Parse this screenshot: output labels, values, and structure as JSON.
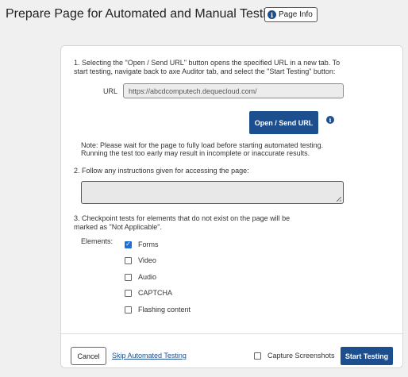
{
  "header": {
    "title": "Prepare Page for Automated and Manual Testing",
    "page_info_label": "Page Info",
    "info_icon": "info-icon"
  },
  "step1": {
    "text": "1. Selecting the \"Open / Send URL\" button opens the specified URL in a new tab. To start testing, navigate back to axe Auditor tab, and select the \"Start Testing\" button:",
    "url_label": "URL",
    "url_value": "https://abcdcomputech.dequecloud.com/",
    "open_send_label": "Open / Send URL",
    "note": "Note: Please wait for the page to fully load before starting automated testing. Running the test too early may result in incomplete or inaccurate results."
  },
  "step2": {
    "text": "2. Follow any instructions given for accessing the page:",
    "instructions_value": ""
  },
  "step3": {
    "text": "3. Checkpoint tests for elements that do not exist on the page will be marked as \"Not Applicable\".",
    "elements_label": "Elements:",
    "elements": [
      {
        "label": "Forms",
        "checked": true
      },
      {
        "label": "Video",
        "checked": false
      },
      {
        "label": "Audio",
        "checked": false
      },
      {
        "label": "CAPTCHA",
        "checked": false
      },
      {
        "label": "Flashing content",
        "checked": false
      }
    ]
  },
  "footer": {
    "cancel_label": "Cancel",
    "skip_label": "Skip Automated Testing",
    "capture_label": "Capture Screenshots",
    "capture_checked": false,
    "start_label": "Start Testing"
  },
  "colors": {
    "primary": "#1d4f8f",
    "checkbox_checked": "#1f6fd4",
    "background": "#f0f0f0"
  }
}
